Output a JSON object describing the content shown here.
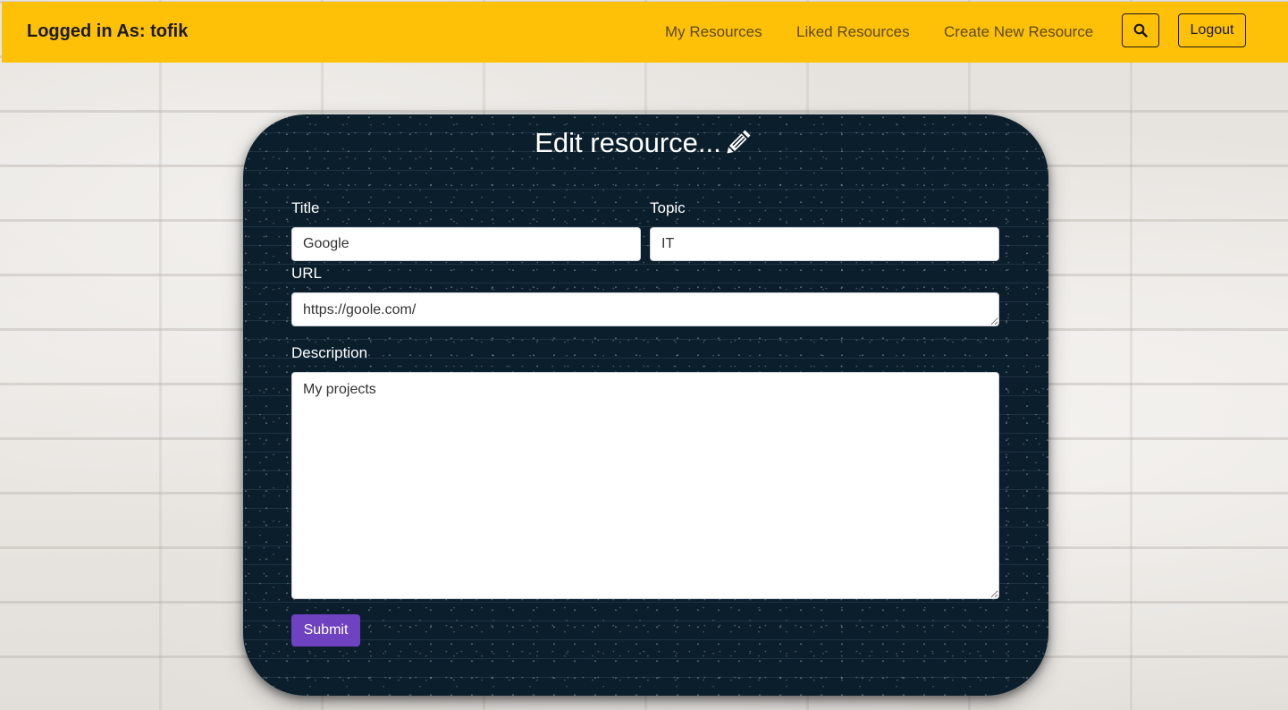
{
  "navbar": {
    "brand": "Logged in As: tofik",
    "links": [
      "My Resources",
      "Liked Resources",
      "Create New Resource"
    ],
    "search_icon": "search-icon",
    "logout_label": "Logout",
    "color": "#ffc107"
  },
  "form": {
    "heading": "Edit resource...",
    "heading_icon": "pencil-icon",
    "title_label": "Title",
    "title_value": "Google",
    "topic_label": "Topic",
    "topic_value": "IT",
    "url_label": "URL",
    "url_value": "https://goole.com/",
    "description_label": "Description",
    "description_value": "My projects",
    "submit_label": "Submit",
    "submit_color": "#6f42c1"
  }
}
